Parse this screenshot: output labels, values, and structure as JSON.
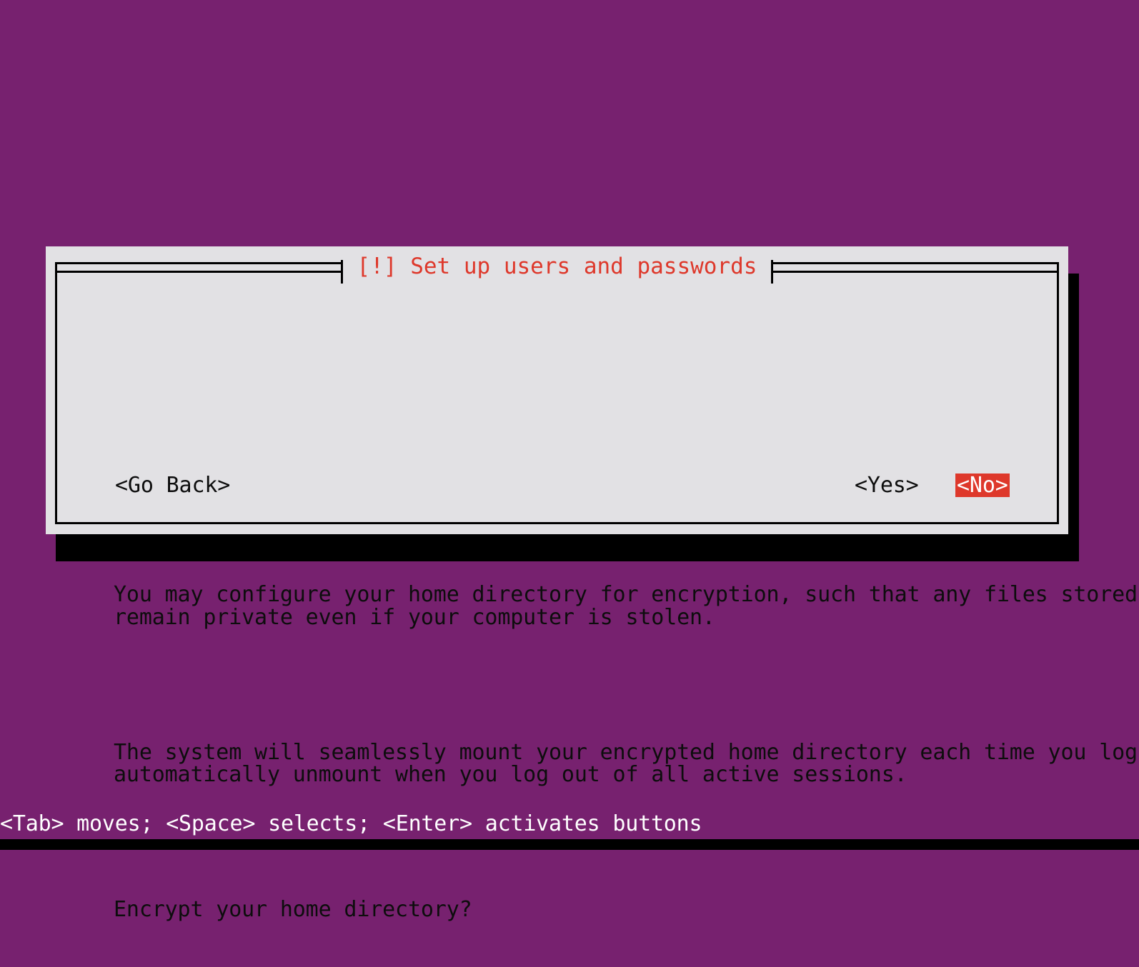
{
  "screen": {
    "kind": "text-mode-installer-dialog",
    "background_color": "#77216F",
    "panel_color": "#E2E1E4",
    "accent_color": "#DE382B",
    "text_color": "#0D0D0D",
    "highlight_text_color": "#FFFFFF"
  },
  "dialog": {
    "title": "[!] Set up users and passwords",
    "paragraphs": [
      "You may configure your home directory for encryption, such that any files stored there\nremain private even if your computer is stolen.",
      "The system will seamlessly mount your encrypted home directory each time you login and\nautomatically unmount when you log out of all active sessions.",
      "Encrypt your home directory?"
    ],
    "buttons": [
      {
        "label": "<Go Back>",
        "selected": false
      },
      {
        "label": "<Yes>",
        "selected": false
      },
      {
        "label": "<No>",
        "selected": true
      }
    ]
  },
  "help_bar": {
    "text": "<Tab> moves; <Space> selects; <Enter> activates buttons"
  }
}
